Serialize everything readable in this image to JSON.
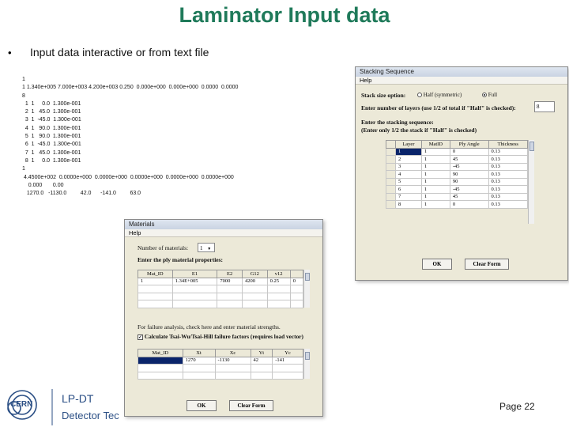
{
  "slide": {
    "title": "Laminator Input data",
    "bullet": "•",
    "subtitle": "Input data interactive or from text file",
    "page": "Page 22"
  },
  "datafile": {
    "lines": [
      "1",
      "1 1.340e+005 7.000e+003 4.200e+003 0.250  0.000e+000  0.000e+000  0.0000  0.0000",
      "8",
      "  1  1     0.0  1.300e-001",
      "  2  1   45.0  1.300e-001",
      "  3  1  -45.0  1.300e-001",
      "  4  1   90.0  1.300e-001",
      "  5  1   90.0  1.300e-001",
      "  6  1  -45.0  1.300e-001",
      "  7  1   45.0  1.300e-001",
      "  8  1     0.0  1.300e-001",
      "1",
      " 4.4500e+002  0.0000e+000  0.0000e+000  0.0000e+000  0.0000e+000  0.0000e+000",
      "    0.000       0.00",
      "   1270.0   -1130.0         42.0      -141.0         63.0"
    ]
  },
  "stacking": {
    "title": "Stacking Sequence",
    "menu": "Help",
    "stack_option_label": "Stack size option:",
    "half_label": "Half (symmetric)",
    "full_label": "Full",
    "layers_label": "Enter number of layers (use 1/2 of total if \"Half\" is checked):",
    "layers_value": "8",
    "enter_seq_label": "Enter the stacking sequence:",
    "enter_seq_note": "(Enter only 1/2 the stack if \"Half\" is checked)",
    "columns": [
      "Layer",
      "MatID",
      "Ply Angle",
      "Thickness"
    ],
    "rows": [
      [
        "1",
        "1",
        "0",
        "0.13"
      ],
      [
        "2",
        "1",
        "45",
        "0.13"
      ],
      [
        "3",
        "1",
        "-45",
        "0.13"
      ],
      [
        "4",
        "1",
        "90",
        "0.13"
      ],
      [
        "5",
        "1",
        "90",
        "0.13"
      ],
      [
        "6",
        "1",
        "-45",
        "0.13"
      ],
      [
        "7",
        "1",
        "45",
        "0.13"
      ],
      [
        "8",
        "1",
        "0",
        "0.13"
      ]
    ],
    "ok_label": "OK",
    "clear_label": "Clear Form"
  },
  "materials": {
    "title": "Materials",
    "menu": "Help",
    "num_label": "Number of materials:",
    "num_value": "1",
    "props_label": "Enter the ply material properties:",
    "prop_columns": [
      "Mat_ID",
      "E1",
      "E2",
      "G12",
      "v12"
    ],
    "prop_row": [
      "1",
      "1.34E+005",
      "7000",
      "4200",
      "0.25",
      "0"
    ],
    "failure_label": "For failure analysis, check here and enter material strengths.",
    "calc_label": "Calculate Tsai-Wu/Tsai-Hill failure factors (requires load vector)",
    "check_mark": "✓",
    "str_columns": [
      "Mat_ID",
      "Xt",
      "Xc",
      "Yt",
      "Yc"
    ],
    "str_row": [
      "1270",
      "-1130",
      "42",
      "-141"
    ],
    "ok_label": "OK",
    "clear_label": "Clear Form"
  },
  "logo": {
    "org": "CERN",
    "dept": "LP-DT",
    "group": "Detector Tec"
  },
  "colors": {
    "title": "#1f7a5a",
    "selection": "#0a246a"
  }
}
